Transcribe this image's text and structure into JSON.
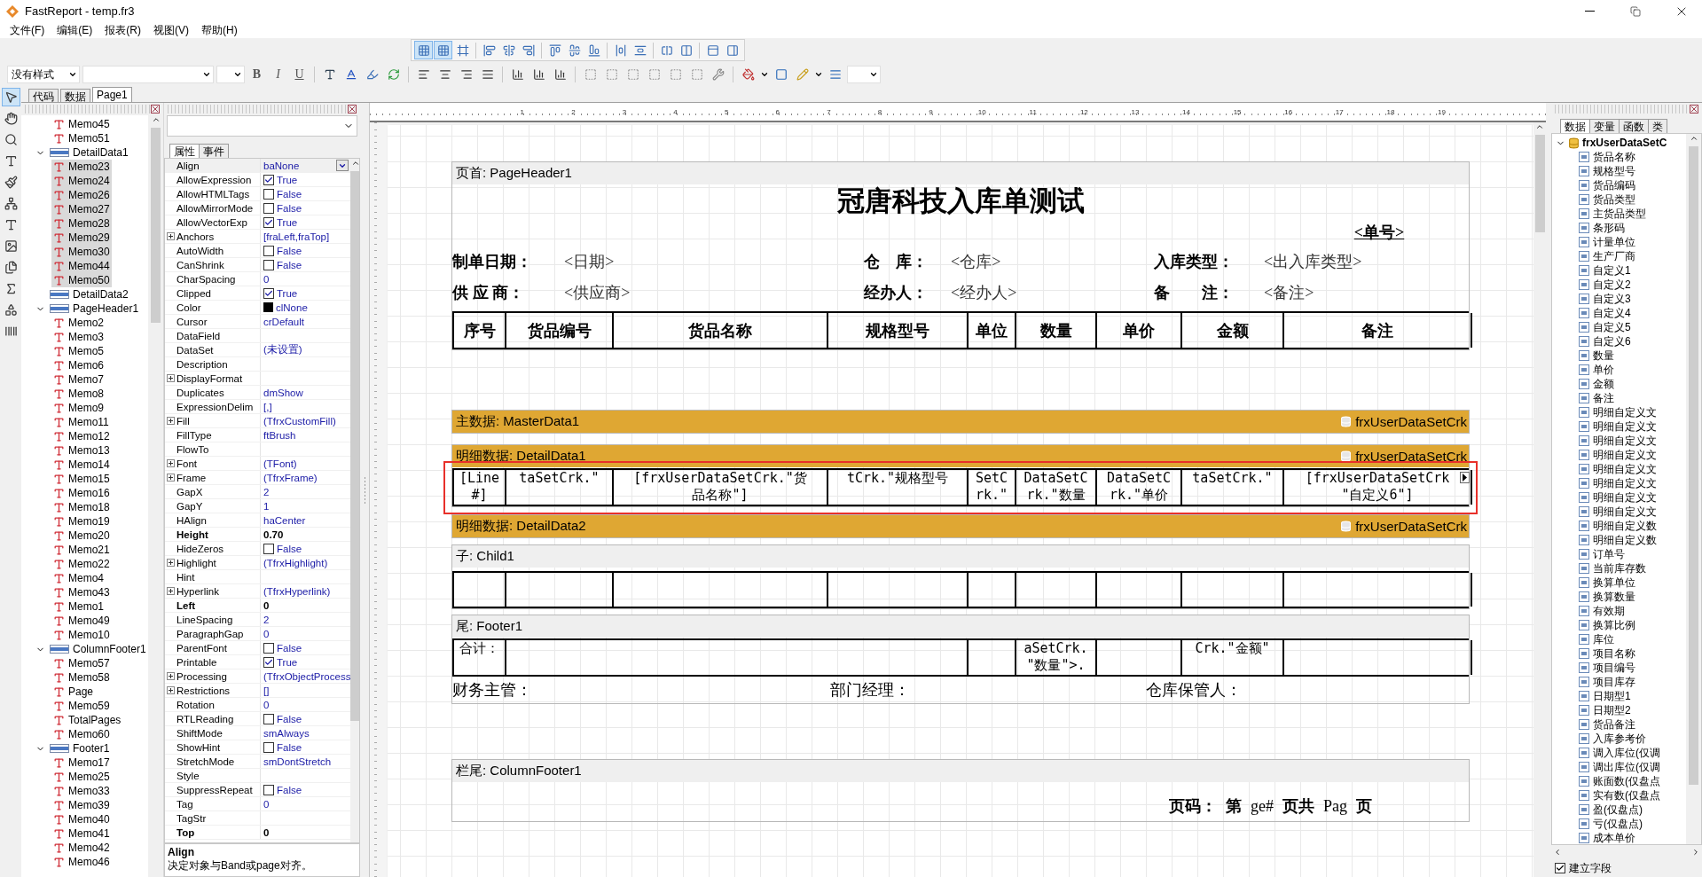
{
  "window": {
    "title": "FastReport - temp.fr3"
  },
  "menu": [
    "文件(F)",
    "编辑(E)",
    "报表(R)",
    "视图(V)",
    "帮助(H)"
  ],
  "toolbar": {
    "toggles": [
      {
        "selected": true
      },
      {
        "selected": true
      },
      {
        "selected": false
      }
    ],
    "style": "没有样式",
    "format_buttons": [
      "B",
      "I",
      "U"
    ]
  },
  "doc_tabs": [
    {
      "label": "代码",
      "selected": false
    },
    {
      "label": "数据",
      "selected": false
    },
    {
      "label": "Page1",
      "selected": true
    }
  ],
  "tools": [
    {
      "kind": "pointer",
      "selected": true
    },
    {
      "kind": "hand",
      "selected": false
    },
    {
      "kind": "zoom",
      "selected": false
    },
    {
      "kind": "text",
      "selected": false
    },
    {
      "kind": "brush",
      "selected": false
    },
    {
      "kind": "tree",
      "selected": false
    },
    {
      "kind": "memo",
      "selected": false
    },
    {
      "kind": "image",
      "selected": false
    },
    {
      "kind": "subreport",
      "selected": false
    },
    {
      "kind": "sum",
      "selected": false
    },
    {
      "kind": "shapes",
      "selected": false
    },
    {
      "kind": "barcode",
      "selected": false
    }
  ],
  "tree": {
    "orphans": [
      {
        "label": "Memo45",
        "selected": false
      },
      {
        "label": "Memo51",
        "selected": false
      }
    ],
    "bands": [
      {
        "label": "DetailData1",
        "selected": false,
        "children": [
          {
            "label": "Memo23",
            "selected": true
          },
          {
            "label": "Memo24",
            "selected": true
          },
          {
            "label": "Memo26",
            "selected": true
          },
          {
            "label": "Memo27",
            "selected": true
          },
          {
            "label": "Memo28",
            "selected": true
          },
          {
            "label": "Memo29",
            "selected": true
          },
          {
            "label": "Memo30",
            "selected": true
          },
          {
            "label": "Memo44",
            "selected": true
          },
          {
            "label": "Memo50",
            "selected": true
          }
        ]
      },
      {
        "label": "DetailData2",
        "selected": false
      },
      {
        "label": "PageHeader1",
        "selected": false,
        "children": [
          {
            "label": "Memo2",
            "selected": false
          },
          {
            "label": "Memo3",
            "selected": false
          },
          {
            "label": "Memo5",
            "selected": false
          },
          {
            "label": "Memo6",
            "selected": false
          },
          {
            "label": "Memo7",
            "selected": false
          },
          {
            "label": "Memo8",
            "selected": false
          },
          {
            "label": "Memo9",
            "selected": false
          },
          {
            "label": "Memo11",
            "selected": false
          },
          {
            "label": "Memo12",
            "selected": false
          },
          {
            "label": "Memo13",
            "selected": false
          },
          {
            "label": "Memo14",
            "selected": false
          },
          {
            "label": "Memo15",
            "selected": false
          },
          {
            "label": "Memo16",
            "selected": false
          },
          {
            "label": "Memo18",
            "selected": false
          },
          {
            "label": "Memo19",
            "selected": false
          },
          {
            "label": "Memo20",
            "selected": false
          },
          {
            "label": "Memo21",
            "selected": false
          },
          {
            "label": "Memo22",
            "selected": false
          },
          {
            "label": "Memo4",
            "selected": false
          },
          {
            "label": "Memo43",
            "selected": false
          },
          {
            "label": "Memo1",
            "selected": false
          },
          {
            "label": "Memo49",
            "selected": false
          },
          {
            "label": "Memo10",
            "selected": false
          }
        ]
      },
      {
        "label": "ColumnFooter1",
        "selected": false,
        "children": [
          {
            "label": "Memo57",
            "selected": false
          },
          {
            "label": "Memo58",
            "selected": false
          },
          {
            "label": "Page",
            "selected": false
          },
          {
            "label": "Memo59",
            "selected": false
          },
          {
            "label": "TotalPages",
            "selected": false
          },
          {
            "label": "Memo60",
            "selected": false
          }
        ]
      },
      {
        "label": "Footer1",
        "selected": false,
        "children": [
          {
            "label": "Memo17",
            "selected": false
          },
          {
            "label": "Memo25",
            "selected": false
          },
          {
            "label": "Memo33",
            "selected": false
          },
          {
            "label": "Memo39",
            "selected": false
          },
          {
            "label": "Memo40",
            "selected": false
          },
          {
            "label": "Memo41",
            "selected": false
          },
          {
            "label": "Memo42",
            "selected": false
          },
          {
            "label": "Memo46",
            "selected": false
          }
        ]
      }
    ]
  },
  "properties": {
    "tabs": [
      {
        "label": "属性",
        "selected": true
      },
      {
        "label": "事件",
        "selected": false
      }
    ],
    "rows": [
      {
        "name": "Align",
        "value": "baNone",
        "kind": "dropdown",
        "selected": true
      },
      {
        "name": "AllowExpression",
        "value": "True",
        "kind": "check",
        "checked": true,
        "selected": false
      },
      {
        "name": "AllowHTMLTags",
        "value": "False",
        "kind": "check",
        "checked": false,
        "selected": false
      },
      {
        "name": "AllowMirrorMode",
        "value": "False",
        "kind": "check",
        "checked": false,
        "selected": false
      },
      {
        "name": "AllowVectorExp",
        "value": "True",
        "kind": "check",
        "checked": true,
        "selected": false
      },
      {
        "name": "Anchors",
        "value": "[fraLeft,fraTop]",
        "kind": "text",
        "expandable": true,
        "selected": false
      },
      {
        "name": "AutoWidth",
        "value": "False",
        "kind": "check",
        "checked": false,
        "selected": false
      },
      {
        "name": "CanShrink",
        "value": "False",
        "kind": "check",
        "checked": false,
        "selected": false
      },
      {
        "name": "CharSpacing",
        "value": "0",
        "kind": "text",
        "selected": false
      },
      {
        "name": "Clipped",
        "value": "True",
        "kind": "check",
        "checked": true,
        "selected": false
      },
      {
        "name": "Color",
        "value": "clNone",
        "kind": "color",
        "color": "#000000",
        "selected": false
      },
      {
        "name": "Cursor",
        "value": "crDefault",
        "kind": "text",
        "selected": false
      },
      {
        "name": "DataField",
        "kind": "text",
        "selected": false
      },
      {
        "name": "DataSet",
        "value": "(未设置)",
        "kind": "text",
        "selected": false
      },
      {
        "name": "Description",
        "kind": "text",
        "selected": false
      },
      {
        "name": "DisplayFormat",
        "kind": "text",
        "expandable": true,
        "selected": false
      },
      {
        "name": "Duplicates",
        "value": "dmShow",
        "kind": "text",
        "selected": false
      },
      {
        "name": "ExpressionDelim",
        "value": "[,]",
        "kind": "text",
        "selected": false
      },
      {
        "name": "Fill",
        "value": "(TfrxCustomFill)",
        "kind": "text",
        "expandable": true,
        "selected": false
      },
      {
        "name": "FillType",
        "value": "ftBrush",
        "kind": "text",
        "selected": false
      },
      {
        "name": "FlowTo",
        "kind": "text",
        "selected": false
      },
      {
        "name": "Font",
        "value": "(TFont)",
        "kind": "text",
        "expandable": true,
        "selected": false
      },
      {
        "name": "Frame",
        "value": "(TfrxFrame)",
        "kind": "text",
        "expandable": true,
        "selected": false
      },
      {
        "name": "GapX",
        "value": "2",
        "kind": "text",
        "selected": false
      },
      {
        "name": "GapY",
        "value": "1",
        "kind": "text",
        "selected": false
      },
      {
        "name": "HAlign",
        "value": "haCenter",
        "kind": "text",
        "selected": false
      },
      {
        "name": "Height",
        "value": "0.70",
        "kind": "text",
        "bold": true,
        "selected": false
      },
      {
        "name": "HideZeros",
        "value": "False",
        "kind": "check",
        "checked": false,
        "selected": false
      },
      {
        "name": "Highlight",
        "value": "(TfrxHighlight)",
        "kind": "text",
        "expandable": true,
        "selected": false
      },
      {
        "name": "Hint",
        "kind": "text",
        "selected": false
      },
      {
        "name": "Hyperlink",
        "value": "(TfrxHyperlink)",
        "kind": "text",
        "expandable": true,
        "selected": false
      },
      {
        "name": "Left",
        "value": "0",
        "kind": "text",
        "bold": true,
        "selected": false
      },
      {
        "name": "LineSpacing",
        "value": "2",
        "kind": "text",
        "selected": false
      },
      {
        "name": "ParagraphGap",
        "value": "0",
        "kind": "text",
        "selected": false
      },
      {
        "name": "ParentFont",
        "value": "False",
        "kind": "check",
        "checked": false,
        "selected": false
      },
      {
        "name": "Printable",
        "value": "True",
        "kind": "check",
        "checked": true,
        "selected": false
      },
      {
        "name": "Processing",
        "value": "(TfrxObjectProcess",
        "kind": "text",
        "expandable": true,
        "selected": false
      },
      {
        "name": "Restrictions",
        "value": "[]",
        "kind": "text",
        "expandable": true,
        "selected": false
      },
      {
        "name": "Rotation",
        "value": "0",
        "kind": "text",
        "selected": false
      },
      {
        "name": "RTLReading",
        "value": "False",
        "kind": "check",
        "checked": false,
        "selected": false
      },
      {
        "name": "ShiftMode",
        "value": "smAlways",
        "kind": "text",
        "selected": false
      },
      {
        "name": "ShowHint",
        "value": "False",
        "kind": "check",
        "checked": false,
        "selected": false
      },
      {
        "name": "StretchMode",
        "value": "smDontStretch",
        "kind": "text",
        "selected": false
      },
      {
        "name": "Style",
        "kind": "text",
        "selected": false
      },
      {
        "name": "SuppressRepeat",
        "value": "False",
        "kind": "check",
        "checked": false,
        "selected": false
      },
      {
        "name": "Tag",
        "value": "0",
        "kind": "text",
        "selected": false
      },
      {
        "name": "TagStr",
        "kind": "text",
        "selected": false
      },
      {
        "name": "Top",
        "value": "0",
        "kind": "text",
        "bold": true,
        "selected": false
      }
    ],
    "help_title": "Align",
    "help_text": "决定对象与Band或page对齐。"
  },
  "ruler": [
    "1",
    "2",
    "3",
    "4",
    "5",
    "6",
    "7",
    "8",
    "9",
    "10",
    "11",
    "12",
    "13",
    "14",
    "15",
    "16",
    "17",
    "18",
    "19"
  ],
  "report": {
    "bands": [
      {
        "kind": "plain",
        "title": "页首: PageHeader1",
        "rows": [
          {
            "kind": "title",
            "text": "冠唐科技入库单测试"
          },
          {
            "kind": "number",
            "text": "<单号>"
          },
          {
            "kind": "info",
            "pairs": [
              {
                "label": "制单日期：",
                "value": "<日期>"
              },
              {
                "label": "仓　库：",
                "value": "<仓库>"
              },
              {
                "label": "入库类型：",
                "value": "<出入库类型>"
              }
            ]
          },
          {
            "kind": "info",
            "pairs": [
              {
                "label": "供 应 商：",
                "value": "<供应商>"
              },
              {
                "label": "经办人：",
                "value": "<经办人>"
              },
              {
                "label": "备　　注：",
                "value": "<备注>"
              }
            ]
          },
          {
            "kind": "head",
            "cells": [
              "序号",
              "货品编号",
              "货品名称",
              "规格型号",
              "单位",
              "数量",
              "单价",
              "金额",
              "备注"
            ]
          }
        ]
      },
      {
        "kind": "data",
        "title": "主数据: MasterData1",
        "dataset": "frxUserDataSetCrk"
      },
      {
        "kind": "data",
        "title": "明细数据: DetailData1",
        "dataset": "frxUserDataSetCrk",
        "rows": [
          {
            "kind": "cells",
            "selected": true,
            "cells": [
              {
                "lines": [
                  "[Line",
                  "#]"
                ]
              },
              {
                "lines": [
                  "taSetCrk.\""
                ]
              },
              {
                "lines": [
                  "[frxUserDataSetCrk.\"货",
                  "品名称\"]"
                ]
              },
              {
                "lines": [
                  "tCrk.\"规格型号"
                ]
              },
              {
                "lines": [
                  "SetC",
                  "rk.\""
                ]
              },
              {
                "lines": [
                  "DataSetC",
                  "rk.\"数量"
                ]
              },
              {
                "lines": [
                  "DataSetC",
                  "rk.\"单价"
                ]
              },
              {
                "lines": [
                  "taSetCrk.\""
                ]
              },
              {
                "lines": [
                  "[frxUserDataSetCrk",
                  "\"自定义6\"]"
                ]
              }
            ]
          }
        ]
      },
      {
        "kind": "data",
        "title": "明细数据: DetailData2",
        "dataset": "frxUserDataSetCrk"
      },
      {
        "kind": "plain",
        "title": "子: Child1",
        "rows": [
          {
            "kind": "empty"
          }
        ]
      },
      {
        "kind": "plain",
        "title": "尾: Footer1",
        "rows": [
          {
            "kind": "cells",
            "selected": false,
            "cells": [
              {
                "lines": [
                  "合计："
                ]
              },
              {},
              {},
              {
                "lines": [
                  "aSetCrk.",
                  "\"数量\">."
                ]
              },
              {},
              {
                "lines": [
                  "Crk.\"金额\""
                ]
              },
              {}
            ]
          },
          {
            "kind": "sign",
            "items": [
              "财务主管：",
              "部门经理：",
              "仓库保管人："
            ]
          }
        ]
      },
      {
        "kind": "plain",
        "title": "栏尾: ColumnFooter1",
        "rows": [
          {
            "kind": "pagenum",
            "items": [
              {
                "text": "页码：",
                "bold": true
              },
              {
                "text": "第",
                "bold": true
              },
              {
                "text": "ge#",
                "bold": false
              },
              {
                "text": "页共",
                "bold": true
              },
              {
                "text": "Pag",
                "bold": false
              },
              {
                "text": "页",
                "bold": true
              }
            ]
          }
        ]
      }
    ]
  },
  "fields": {
    "tabs": [
      {
        "label": "数据",
        "selected": true
      },
      {
        "label": "变量",
        "selected": false
      },
      {
        "label": "函数",
        "selected": false
      },
      {
        "label": "类",
        "selected": false
      }
    ],
    "root": "frxUserDataSetC",
    "items": [
      "货品名称",
      "规格型号",
      "货品编码",
      "货品类型",
      "主货品类型",
      "条形码",
      "计量单位",
      "生产厂商",
      "自定义1",
      "自定义2",
      "自定义3",
      "自定义4",
      "自定义5",
      "自定义6",
      "数量",
      "单价",
      "金额",
      "备注",
      "明细自定义文",
      "明细自定义文",
      "明细自定义文",
      "明细自定义文",
      "明细自定义文",
      "明细自定义文",
      "明细自定义文",
      "明细自定义文",
      "明细自定义数",
      "明细自定义数",
      "订单号",
      "当前库存数",
      "换算单位",
      "换算数量",
      "有效期",
      "换算比例",
      "库位",
      "项目名称",
      "项目编号",
      "项目库存",
      "日期型1",
      "日期型2",
      "货品备注",
      "入库参考价",
      "调入库位(仅调",
      "调出库位(仅调",
      "账面数(仅盘点",
      "实有数(仅盘点",
      "盈(仅盘点)",
      "亏(仅盘点)",
      "成本单价"
    ],
    "create_fields": {
      "label": "建立字段",
      "checked": true
    }
  }
}
